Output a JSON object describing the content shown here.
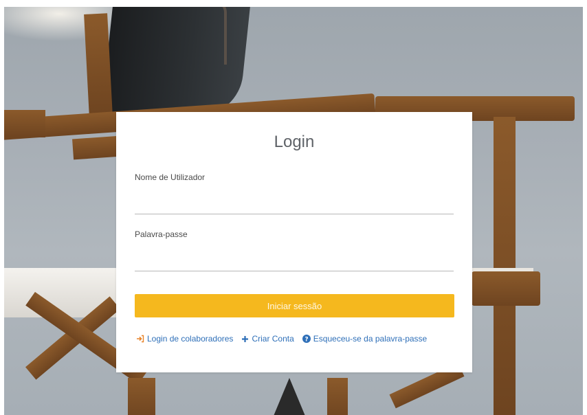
{
  "login": {
    "title": "Login",
    "username": {
      "label": "Nome de Utilizador",
      "value": "",
      "placeholder": ""
    },
    "password": {
      "label": "Palavra-passe",
      "value": "",
      "placeholder": ""
    },
    "submit_label": "Iniciar sessão",
    "links": {
      "collaborators": {
        "label": "Login de colaboradores",
        "icon": "sign-in-icon"
      },
      "create_account": {
        "label": "Criar Conta",
        "icon": "plus-icon"
      },
      "forgot_password": {
        "label": "Esqueceu-se da palavra-passe",
        "icon": "question-circle-icon"
      }
    }
  },
  "colors": {
    "accent": "#f5b81e",
    "link": "#2e6fb8",
    "icon_orange": "#e8842a"
  }
}
